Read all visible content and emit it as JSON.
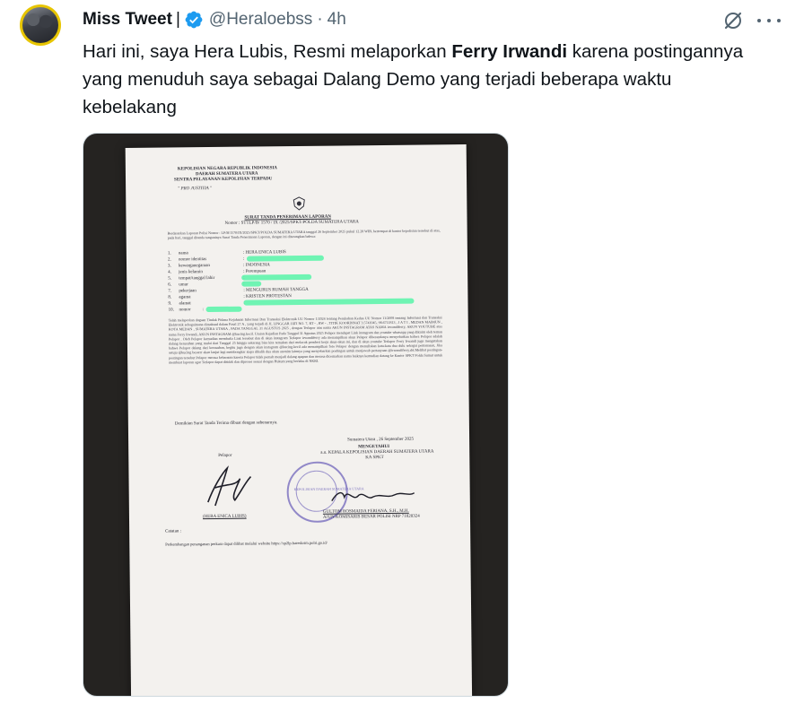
{
  "author": {
    "name": "Miss Tweet",
    "separator": "|",
    "handle": "@Heraloebss",
    "dot": "·",
    "time": "4h"
  },
  "tweet": {
    "text_before": "Hari ini, saya Hera Lubis,  Resmi melaporkan ",
    "text_bold": "Ferry Irwandi",
    "text_after": " karena postingannya yang menuduh saya sebagai Dalang Demo yang terjadi beberapa waktu kebelakang"
  },
  "document": {
    "org_lines": [
      "KEPOLISIAN NEGARA REPUBLIK INDONESIA",
      "DAERAH SUMATERA UTARA",
      "SENTRA PELAYANAN KEPOLISIAN TERPADU"
    ],
    "pro_justitia": "\" PRO JUSTITIA \"",
    "title": "SURAT TANDA PENERIMAAN LAPORAN",
    "nomor": "Nomor : STTLP/B/ 1570 / IX /2025/SPKT/POLDA SUMATERA UTARA",
    "intro": "Berdasarkan Laporan Polisi Nomor : LP/B/1570/IX/2025/SPKT/POLDA SUMATERA UTARA tanggal 26 September 2025 pukul 12.28 WIB, bertempat di kantor kepolisian tersebut di atas, pada hari, tanggal ditanda tanganinya Surat Tanda Penerimaan Laporan, dengan ini diterangkan bahwa:",
    "fields": [
      {
        "no": "1.",
        "label": "nama",
        "value": ": HERA ENICA LUBIS"
      },
      {
        "no": "2.",
        "label": "nomor identitas",
        "value": ":"
      },
      {
        "no": "3.",
        "label": "kewarganegaraan",
        "value": ": INDONESIA"
      },
      {
        "no": "4.",
        "label": "jenis kelamin",
        "value": ": Perempuan"
      },
      {
        "no": "5.",
        "label": "tempat/tanggal lahir",
        "value": ":"
      },
      {
        "no": "6.",
        "label": "umur",
        "value": ":"
      },
      {
        "no": "7.",
        "label": "pekerjaan",
        "value": ": MENGURUS RUMAH TANGGA"
      },
      {
        "no": "8.",
        "label": "agama",
        "value": ": KRISTEN PROTESTAN"
      },
      {
        "no": "9.",
        "label": "alamat",
        "value": ":"
      },
      {
        "no": "10.",
        "label": "nomor",
        "value": ":"
      }
    ],
    "body": "Telah melaporkan dugaan Tindak Pidana Kejahatan Informasi Dan Transaksi Elektronik UU Nomor 1/2024 tentang Perubahan Kedua UU Nomor 11/2008 tentang Informasi dan Transaksi Elektronik sebagaimana dimaksud dalam Pasal 27 A , yang terjadi di JL LINGGAR JATI NO. 7, RT - , RW - , TITIK KOORDINAT 3.5741045, 98.6711813 , J A T I , MEDAN MAIMUN , KOTA MEDAN , SUMATERA UTARA , PADA TANGGAL 31 AGUSTUS 2025 , dengan Terlapor atas nama AKUN INSTAGRAM ATAS NAMA irwandiferry, AKUN YOUTUBE atas nama Ferry Irwandi, AKUN INSTAGRAM @kucing.kecil. Uraian Kejadian Pada Tanggal 31 Agustus 2025 Pelapor mendapat Link instagram dan youtube whatsapp yang dikirim oleh teman Pelapor . Oleh Pelapor kemudian membuka Link tersebut dan di akun instagram Terlapor irwandiferry ada menampilkan akun Pelapor diberandanya menyebutkan bahwa Pelapor adalah dalang kerusuhan yang mulai dari Tanggal 25 hingga sekarang bisa kita temukan dari melacak pemberi kerja akun-akun ini, dan di akun youtube Terlapor Ferry Irwandi juga mengatakan bahwa Pelapor dalang dari kerusuhan, begitu juga dengan akun instagram @kucing.kecil ada menampilkan foto Pelapor dengan menuliskan kata-kata dua dulu sebagai pemanasan, Jika setuju @kucing besarrr akan lanjut lagi membongkar siapa dibalik dua akun anonim lainnya yang menyebarkan postingan untuk menjawab pertanyaan @irwandiferry.dst.Melihat postingan-postingan tersebut Pelapor merasa kebaratan karena Pelapor tidak pernah menjadi dalang apapun dan merasa dicemarkan nama baiknya kemudian datang ke Kantor SPKT Polda Sumut untuk membuat laporan agar Terlapor dapat ditidak dan diproses sesuai dengan Hukum yang berlaku di NKRI.",
    "closing": "Demikian Surat Tanda Terima dibuat dengan sebenarnya.",
    "place_date": "Sumatera Utara , 26 September 2025",
    "pelapor_label": "Pelapor",
    "pelapor_name": "(HERA ENICA LUBIS)",
    "mengetahui": "MENGETAHUI",
    "an_line": "a.n. KEPALA KEPOLISIAN DAERAH SUMATERA UTARA",
    "ka_spkt": "KA SPKT",
    "officer_name": "GULTOM ROSMAIDA FERIANA, S.H., M.H.",
    "officer_rank": "AJUN KOMISARIS BESAR POLISI NRP 71020324",
    "stamp_text": "KEPOLISIAN DAERAH SUMATERA UTARA",
    "catatan": "Catatan :",
    "catatan_text": "Perkembangan penanganan perkara dapat dilihat melalui website https://sp2lp.bareskrim.polri.go.id/"
  },
  "colors": {
    "verified": "#1d9bf0",
    "text": "#0f1419",
    "secondary": "#536471",
    "highlight": "#57f5a8"
  },
  "icons": [
    "verified-badge-icon",
    "grok-icon",
    "more-options-icon"
  ]
}
